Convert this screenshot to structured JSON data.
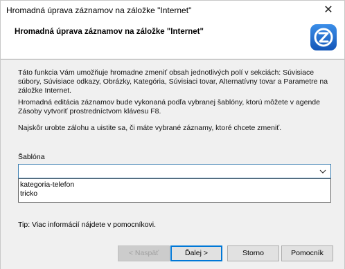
{
  "window": {
    "title": "Hromadná úprava záznamov na záložke \"Internet\"",
    "close_glyph": "✕"
  },
  "header": {
    "heading": "Hromadná úprava záznamov na záložke \"Internet\"",
    "logo_icon": "z-logo-icon",
    "logo_color": "#1e6fd0"
  },
  "body": {
    "paragraph1": "Táto funkcia Vám umožňuje hromadne zmeniť obsah jednotlivých polí v sekciách: Súvisiace súbory, Súvisiace odkazy, Obrázky, Kategória, Súvisiaci tovar, Alternatívny tovar a Parametre na záložke Internet.",
    "paragraph2": "Hromadná editácia záznamov bude vykonaná podľa vybranej šablóny, ktorú môžete v agende Zásoby vytvoriť prostredníctvom klávesu F8.",
    "paragraph3": "Najskôr urobte zálohu a uistite sa, či máte vybrané záznamy, ktoré chcete zmeniť.",
    "template_label": "Šablóna",
    "template_value": "",
    "template_options": [
      "kategoria-telefon",
      "tricko"
    ],
    "tip": "Tip: Viac informácií nájdete v pomocníkovi."
  },
  "footer": {
    "prev_label": "< Naspäť",
    "next_label": "Ďalej >",
    "cancel_label": "Storno",
    "help_label": "Pomocník"
  },
  "colors": {
    "accent": "#0078d7",
    "select_border": "#3c7fb1"
  }
}
